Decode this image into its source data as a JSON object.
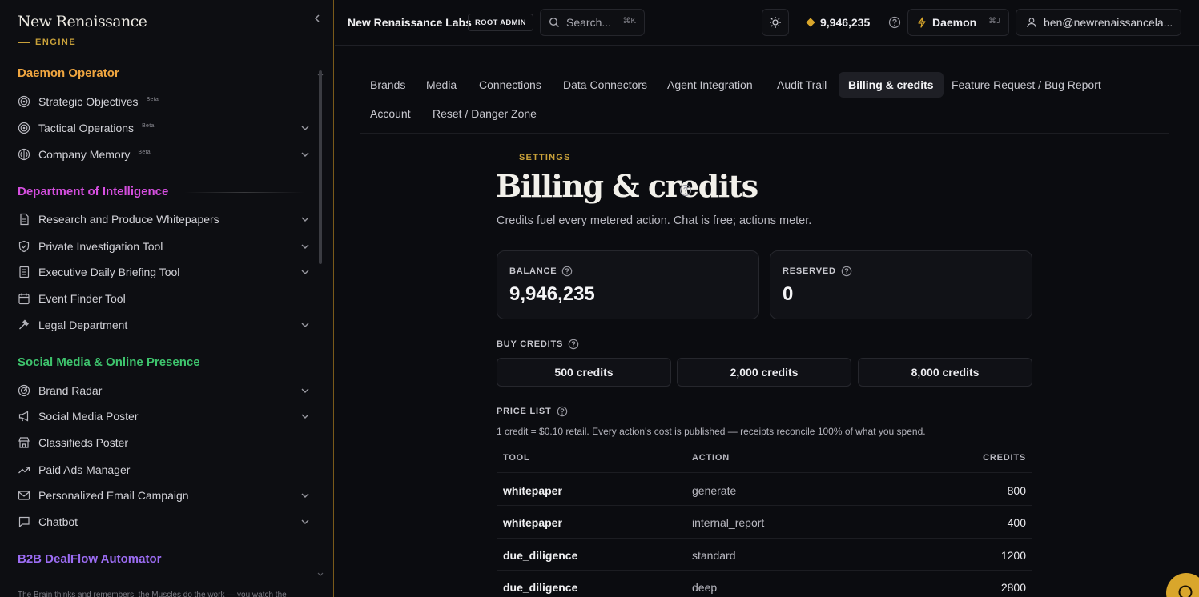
{
  "brand": {
    "name": "New Renaissance",
    "sub": "ENGINE"
  },
  "sidebar": {
    "sections": [
      {
        "title": "Daemon Operator",
        "color": "#f0a640"
      },
      {
        "title": "Department of Intelligence",
        "color": "#d64fe0"
      },
      {
        "title": "Social Media & Online Presence",
        "color": "#3ec46d"
      },
      {
        "title": "B2B DealFlow Automator",
        "color": "#9b6cf2"
      }
    ],
    "items": [
      {
        "label": "Strategic Objectives",
        "badge": "Beta",
        "icon": "target-icon"
      },
      {
        "label": "Tactical Operations",
        "badge": "Beta",
        "icon": "target-icon"
      },
      {
        "label": "Company Memory",
        "badge": "Beta",
        "icon": "brain-icon"
      },
      {
        "label": "Research and Produce Whitepapers",
        "icon": "document-icon"
      },
      {
        "label": "Private Investigation Tool",
        "icon": "shield-icon"
      },
      {
        "label": "Executive Daily Briefing Tool",
        "icon": "newspaper-icon"
      },
      {
        "label": "Event Finder Tool",
        "icon": "calendar-icon"
      },
      {
        "label": "Legal Department",
        "icon": "gavel-icon"
      },
      {
        "label": "Brand Radar",
        "icon": "radar-icon"
      },
      {
        "label": "Social Media Poster",
        "icon": "megaphone-icon"
      },
      {
        "label": "Classifieds Poster",
        "icon": "store-icon"
      },
      {
        "label": "Paid Ads Manager",
        "icon": "trend-icon"
      },
      {
        "label": "Personalized Email Campaign",
        "icon": "mail-icon"
      },
      {
        "label": "Chatbot",
        "icon": "chat-icon"
      }
    ],
    "footer_text": "The Brain thinks and remembers; the Muscles do the work — you watch the"
  },
  "topbar": {
    "org": "New Renaissance Labs",
    "role_badge": "ROOT ADMIN",
    "search_placeholder": "Search...",
    "search_kbd": "⌘K",
    "credits": "9,946,235",
    "daemon_label": "Daemon",
    "daemon_kbd": "⌘J",
    "user_email": "ben@newrenaissancela..."
  },
  "tabs": [
    {
      "label": "Brands"
    },
    {
      "label": "Media"
    },
    {
      "label": "Connections"
    },
    {
      "label": "Data Connectors"
    },
    {
      "label": "Agent Integration"
    },
    {
      "label": "Audit Trail"
    },
    {
      "label": "Billing & credits",
      "active": true
    },
    {
      "label": "Feature Request / Bug Report"
    },
    {
      "label": "Account"
    },
    {
      "label": "Reset / Danger Zone"
    }
  ],
  "page": {
    "eyebrow": "SETTINGS",
    "title": "Billing & credits",
    "subtitle": "Credits fuel every metered action. Chat is free; actions meter.",
    "balance_label": "BALANCE",
    "balance_value": "9,946,235",
    "reserved_label": "RESERVED",
    "reserved_value": "0",
    "buy_label": "BUY CREDITS",
    "buy_options": [
      "500 credits",
      "2,000 credits",
      "8,000 credits"
    ],
    "price_label": "PRICE LIST",
    "price_note": "1 credit = $0.10 retail. Every action's cost is published — receipts reconcile 100% of what you spend.",
    "table": {
      "headers": [
        "TOOL",
        "ACTION",
        "CREDITS"
      ],
      "rows": [
        {
          "tool": "whitepaper",
          "action": "generate",
          "credits": "800"
        },
        {
          "tool": "whitepaper",
          "action": "internal_report",
          "credits": "400"
        },
        {
          "tool": "due_diligence",
          "action": "standard",
          "credits": "1200"
        },
        {
          "tool": "due_diligence",
          "action": "deep",
          "credits": "2800"
        }
      ]
    }
  },
  "colors": {
    "accent": "#d9a62b",
    "background": "#0b0c10",
    "sidebar_border": "#7a5a1a"
  }
}
